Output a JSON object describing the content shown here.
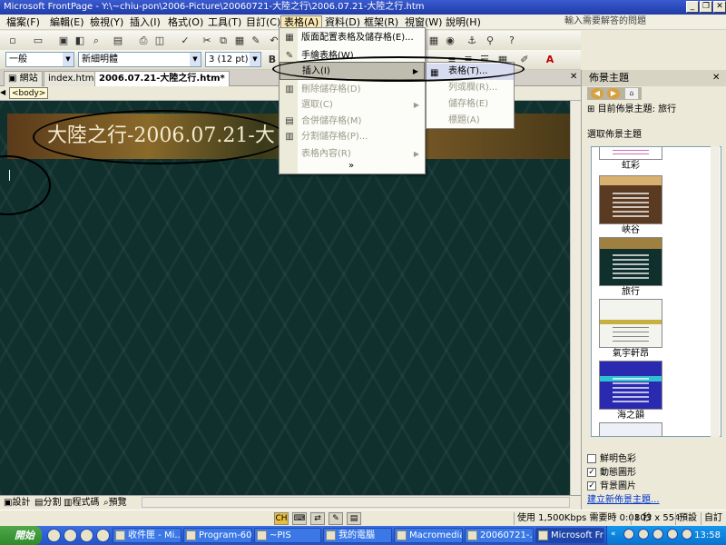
{
  "window": {
    "title": "Microsoft FrontPage - Y:\\~chiu-pon\\2006-Picture\\20060721-大陸之行\\2006.07.21-大陸之行.htm"
  },
  "menu": {
    "items": [
      "檔案(F)",
      "編輯(E)",
      "檢視(Y)",
      "插入(I)",
      "格式(O)",
      "工具(T)",
      "目訂(C)",
      "表格(A)",
      "資料(D)",
      "框架(R)",
      "視窗(W)",
      "說明(H)"
    ],
    "ask_placeholder": "輸入需要解答的問題"
  },
  "toolbar": {
    "style_value": "一般",
    "font_value": "新細明體",
    "size_value": "3 (12 pt)",
    "bold": "B"
  },
  "tabs": {
    "website": "網站",
    "items": [
      "index.html*",
      "2006.07.21-大陸之行.htm*"
    ]
  },
  "tag": "<body>",
  "editor": {
    "banner_text": "大陸之行-2006.07.21-大"
  },
  "table_menu": {
    "items": [
      {
        "label": "版面配置表格及儲存格(E)...",
        "enabled": true
      },
      {
        "label": "手繪表格(W)",
        "enabled": true
      },
      {
        "label": "插入(I)",
        "enabled": true,
        "submenu": true,
        "highlighted": true
      },
      {
        "label": "刪除儲存格(D)",
        "enabled": false
      },
      {
        "label": "選取(C)",
        "enabled": false,
        "submenu": true
      },
      {
        "label": "合併儲存格(M)",
        "enabled": false
      },
      {
        "label": "分割儲存格(P)...",
        "enabled": false
      },
      {
        "label": "表格內容(R)",
        "enabled": false,
        "submenu": true
      }
    ],
    "expand": "»"
  },
  "insert_submenu": {
    "items": [
      {
        "label": "表格(T)...",
        "enabled": true
      },
      {
        "label": "列或欄(R)...",
        "enabled": false
      },
      {
        "label": "儲存格(E)",
        "enabled": false
      },
      {
        "label": "標題(A)",
        "enabled": false
      }
    ]
  },
  "view_tabs": [
    "設計",
    "分割",
    "程式碼",
    "預覽"
  ],
  "status": {
    "speed": "使用 1,500Kbps 需要時 0:01 秒",
    "dimensions": "803 x 554",
    "mode": "預設",
    "custom": "自訂"
  },
  "task_pane": {
    "title": "佈景主題",
    "current_theme": "目前佈景主題: 旅行",
    "select_label": "選取佈景主題",
    "themes": [
      {
        "name": "虹彩",
        "bg": "#ffffff",
        "accent": "#c03090"
      },
      {
        "name": "峽谷",
        "bg": "#5a3a20",
        "accent": "#d8b070"
      },
      {
        "name": "旅行",
        "bg": "#10302e",
        "accent": "#a08040"
      },
      {
        "name": "氣宇軒昂",
        "bg": "#f4f4ee",
        "accent": "#c8b040"
      },
      {
        "name": "海之韻",
        "bg": "#2a2ab0",
        "accent": "#30c0d0"
      },
      {
        "name": "",
        "bg": "#eef0f8",
        "accent": "#8090c0"
      }
    ],
    "options": [
      {
        "label": "鮮明色彩",
        "checked": false
      },
      {
        "label": "動態圖形",
        "checked": true
      },
      {
        "label": "背景圖片",
        "checked": true
      }
    ],
    "create_link": "建立新佈景主題..."
  },
  "taskbar": {
    "start": "開始",
    "tasks": [
      "收件匣 - Mi...",
      "Program-60...",
      "~PIS",
      "我的電腦",
      "Macromedia...",
      "20060721-...",
      "Microsoft Fr..."
    ],
    "clock": "13:58"
  }
}
